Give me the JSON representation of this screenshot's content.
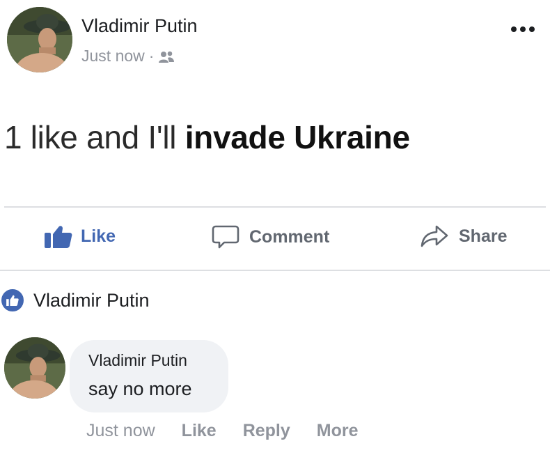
{
  "post": {
    "author": "Vladimir Putin",
    "timestamp": "Just now",
    "separator": "·",
    "audience_icon": "friends-icon",
    "text_light": "1 like and I'll",
    "text_bold": "invade Ukraine"
  },
  "actions": {
    "like_label": "Like",
    "comment_label": "Comment",
    "share_label": "Share"
  },
  "reactions": {
    "icon": "like-icon",
    "names": "Vladimir Putin"
  },
  "comment": {
    "author": "Vladimir Putin",
    "text": "say no more",
    "timestamp": "Just now",
    "like_label": "Like",
    "reply_label": "Reply",
    "more_label": "More"
  },
  "colors": {
    "accent": "#4267b2",
    "muted_text": "#90949c",
    "bubble": "#f0f2f5",
    "divider": "#dddfe2"
  }
}
